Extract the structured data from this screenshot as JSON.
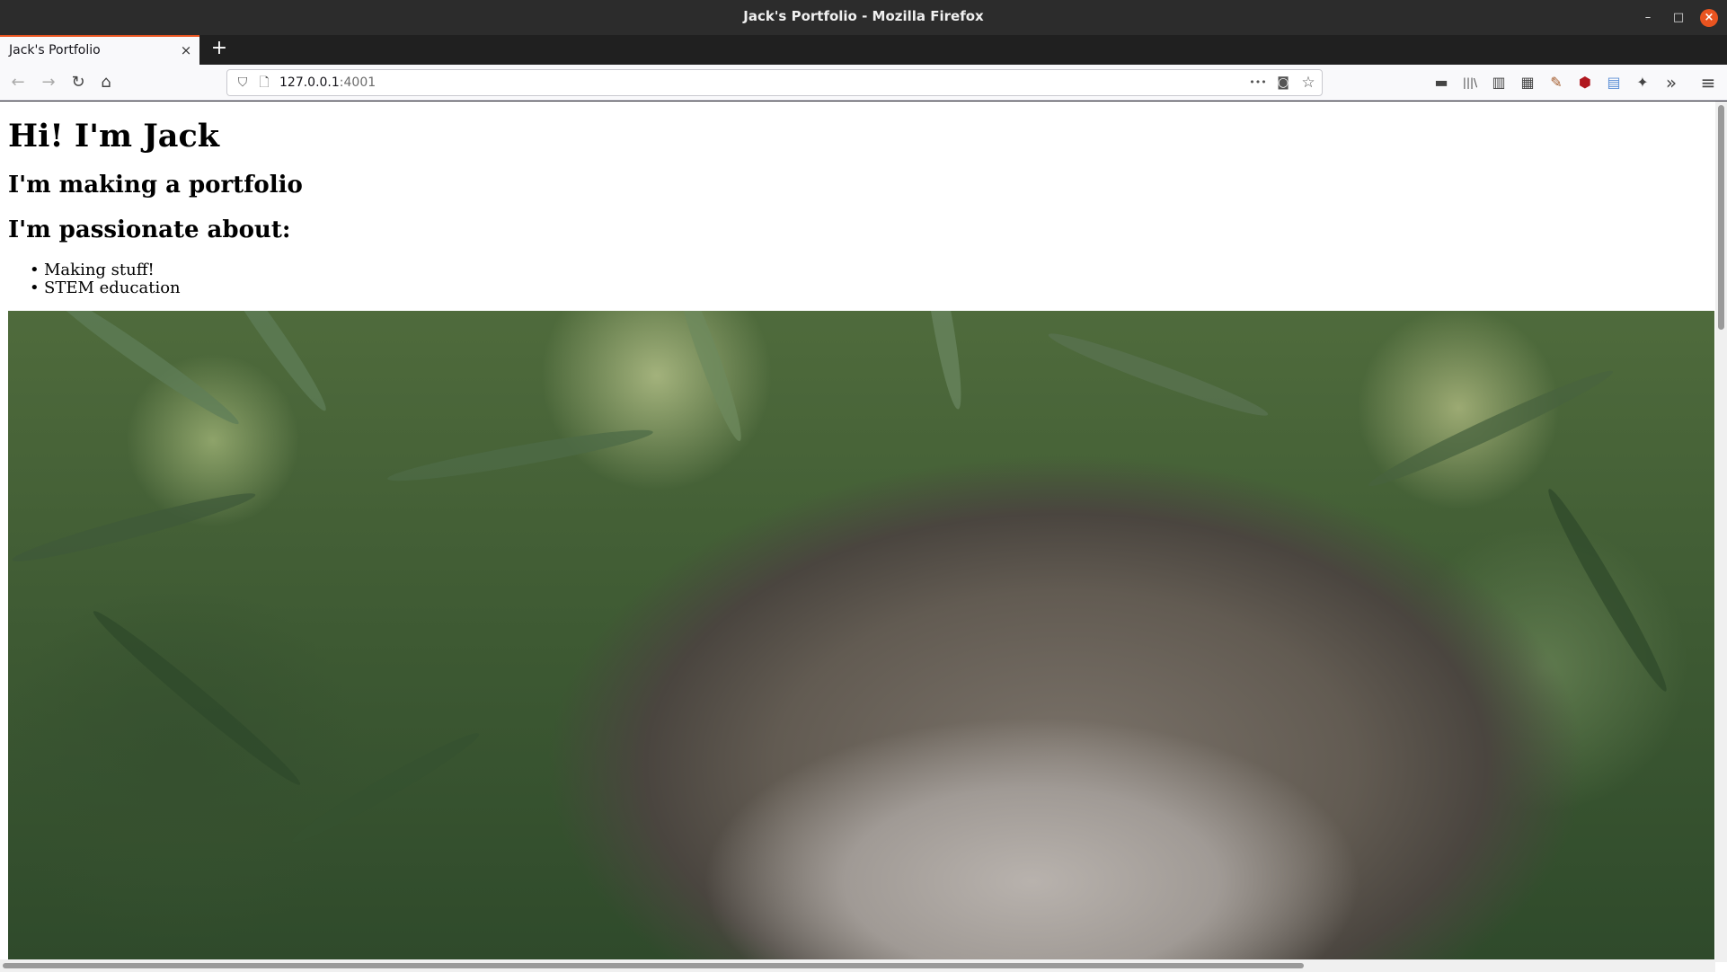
{
  "window": {
    "title": "Jack's Portfolio - Mozilla Firefox",
    "controls": {
      "minimize": "–",
      "maximize": "□",
      "close": "×"
    }
  },
  "tabs": [
    {
      "label": "Jack's Portfolio",
      "close": "×"
    }
  ],
  "new_tab": "+",
  "nav": {
    "back": "←",
    "forward": "→",
    "reload": "↻",
    "home": "⌂"
  },
  "urlbar": {
    "host": "127.0.0.1",
    "port": ":4001",
    "shield_icon": "⛉",
    "page_icon": "🗋",
    "more": "•••",
    "pocket": "◙",
    "bookmark_star": "☆"
  },
  "toolbar_icons": [
    "▬",
    "|||\\",
    "▥",
    "▦",
    "✎",
    "⬢",
    "▤",
    "✦",
    "»",
    "≡"
  ],
  "page": {
    "heading": "Hi! I'm Jack",
    "subheading": "I'm making a portfolio",
    "passion_heading": "I'm passionate about:",
    "passions": [
      "Making stuff!",
      "STEM education"
    ]
  },
  "photo": {
    "description_icon": "portrait-photo"
  }
}
